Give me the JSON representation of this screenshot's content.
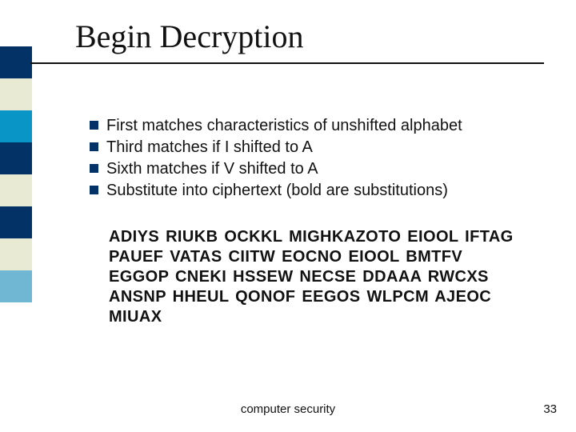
{
  "title": "Begin Decryption",
  "bullets": [
    "First matches characteristics of unshifted alphabet",
    "Third matches if I shifted to A",
    "Sixth matches if V shifted to A",
    "Substitute into ciphertext (bold are substitutions)"
  ],
  "ciphertext": "ADIYS RIUKB OCKKL MIGHKAZOTO EIOOL IFTAG PAUEF VATAS CIITW EOCNO EIOOL BMTFV EGGOP CNEKI HSSEW NECSE DDAAA RWCXS ANSNP HHEUL QONOF EEGOS WLPCM AJEOC MIUAX",
  "footer": {
    "center": "computer security",
    "right": "33"
  },
  "stripe_colors": [
    "#033266",
    "#e8ead3",
    "#0995c6",
    "#033266",
    "#e8ead3",
    "#033266",
    "#e8ead3",
    "#70b7d4"
  ]
}
